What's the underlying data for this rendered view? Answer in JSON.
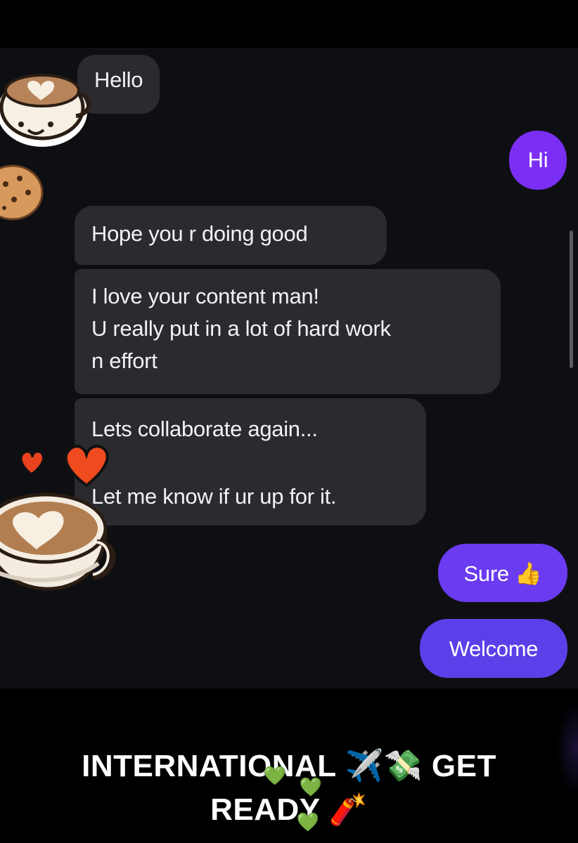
{
  "conversation": {
    "messages": [
      {
        "side": "received",
        "text": "Hello"
      },
      {
        "side": "sent",
        "text": "Hi"
      },
      {
        "side": "received",
        "text": "Hope you r doing good"
      },
      {
        "side": "received",
        "text": "I love your content man!\nU really put in a lot of hard work\nn effort"
      },
      {
        "side": "received",
        "text": "Lets collaborate again...\n\nLet me know if ur up for it."
      },
      {
        "side": "sent",
        "text": "Sure 👍"
      },
      {
        "side": "sent",
        "text": "Welcome"
      }
    ]
  },
  "overlay": {
    "caption_line1_word1": "INTERNATIO",
    "caption_line1_word2": "NAL",
    "caption_line1_emojis": "✈️💸",
    "caption_line1_end": "GET",
    "caption_line2_start": "READ",
    "caption_line2_end": "Y",
    "caption_line2_emoji": "🧨",
    "heart_emoji": "💚"
  },
  "stickers": [
    "latte-art-cup-smiling",
    "cookie",
    "red-hearts",
    "latte-art-cup"
  ],
  "colors": {
    "background": "#0e0f12",
    "received_bubble": "#2a2b2f",
    "sent_bubble": "#7b2ff4",
    "text": "#f2f2f4"
  }
}
